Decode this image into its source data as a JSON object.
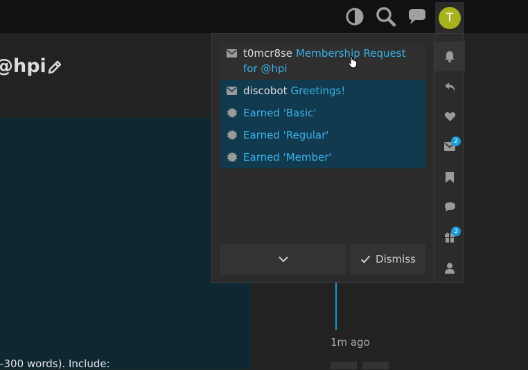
{
  "header": {
    "icons": [
      "theme-toggle-icon",
      "search-icon",
      "chat-icon"
    ],
    "avatar_letter": "T",
    "avatar_color": "#a6b31d"
  },
  "topic": {
    "title": "@hpi",
    "body_excerpt": "–300 words). Include:"
  },
  "timeline": {
    "time_ago": "1m ago"
  },
  "notifications": [
    {
      "icon": "envelope-icon",
      "user": "t0mcr8se",
      "text": "Membership Request for @hpi",
      "state": "read"
    },
    {
      "icon": "envelope-icon",
      "user": "discobot",
      "text": "Greetings!",
      "state": "unread"
    },
    {
      "icon": "badge-icon",
      "user": "",
      "text": "Earned 'Basic'",
      "state": "unread"
    },
    {
      "icon": "badge-icon",
      "user": "",
      "text": "Earned 'Regular'",
      "state": "unread"
    },
    {
      "icon": "badge-icon",
      "user": "",
      "text": "Earned 'Member'",
      "state": "unread"
    }
  ],
  "panel": {
    "dismiss_label": "Dismiss",
    "rail": [
      {
        "icon": "bell-icon",
        "badge": ""
      },
      {
        "icon": "reply-icon",
        "badge": ""
      },
      {
        "icon": "heart-icon",
        "badge": ""
      },
      {
        "icon": "envelope-icon",
        "badge": "2"
      },
      {
        "icon": "bookmark-icon",
        "badge": ""
      },
      {
        "icon": "chat-bubble-icon",
        "badge": ""
      },
      {
        "icon": "gift-icon",
        "badge": "3"
      },
      {
        "icon": "user-icon",
        "badge": ""
      }
    ]
  },
  "colors": {
    "accent": "#3ab1e8",
    "unread_bg": "#113a4f",
    "panel_bg": "#2b2b2b",
    "post_bg": "#0e2733"
  }
}
